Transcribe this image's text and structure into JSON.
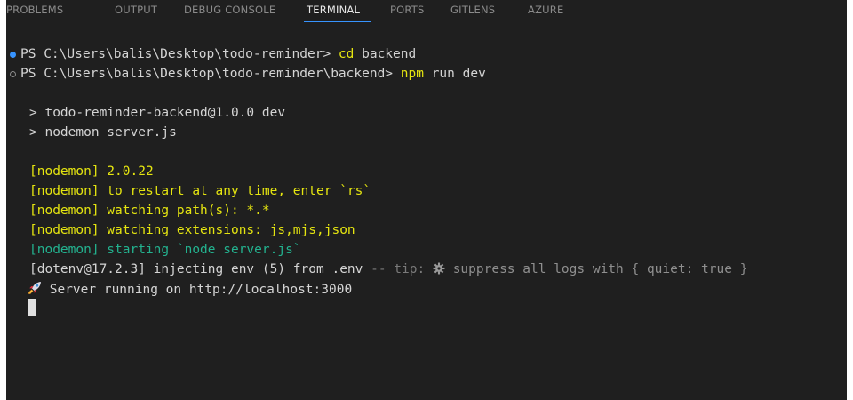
{
  "panel_tabs": [
    {
      "label": "PROBLEMS"
    },
    {
      "label": "OUTPUT"
    },
    {
      "label": "DEBUG CONSOLE"
    },
    {
      "label": "TERMINAL"
    },
    {
      "label": "PORTS"
    },
    {
      "label": "GITLENS"
    },
    {
      "label": "AZURE"
    }
  ],
  "active_tab": "TERMINAL",
  "terminal": {
    "prompt1": {
      "path": "PS C:\\Users\\balis\\Desktop\\todo-reminder> ",
      "command": "cd",
      "args": " backend"
    },
    "prompt2": {
      "path": "PS C:\\Users\\balis\\Desktop\\todo-reminder\\backend> ",
      "command": "npm",
      "args": " run dev"
    },
    "npm_script_line1": "> todo-reminder-backend@1.0.0 dev",
    "npm_script_line2": "> nodemon server.js",
    "nodemon_lines": [
      "[nodemon] 2.0.22",
      "[nodemon] to restart at any time, enter `rs`",
      "[nodemon] watching path(s): *.*",
      "[nodemon] watching extensions: js,mjs,json"
    ],
    "nodemon_start": "[nodemon] starting `node server.js`",
    "dotenv_line": {
      "main": "[dotenv@17.2.3] injecting env (5) from .env",
      "tip_prefix": " -- tip: ",
      "tip_text": " suppress all logs with { quiet: true }"
    },
    "server_line": " Server running on http://localhost:3000"
  },
  "colors": {
    "background": "#1f1f1f",
    "accent": "#3794ff",
    "nodemon_yellow": "#e5e510",
    "nodemon_green": "#23b28f"
  },
  "icons": {
    "rocket": "rocket-icon",
    "gear": "gear-icon"
  }
}
